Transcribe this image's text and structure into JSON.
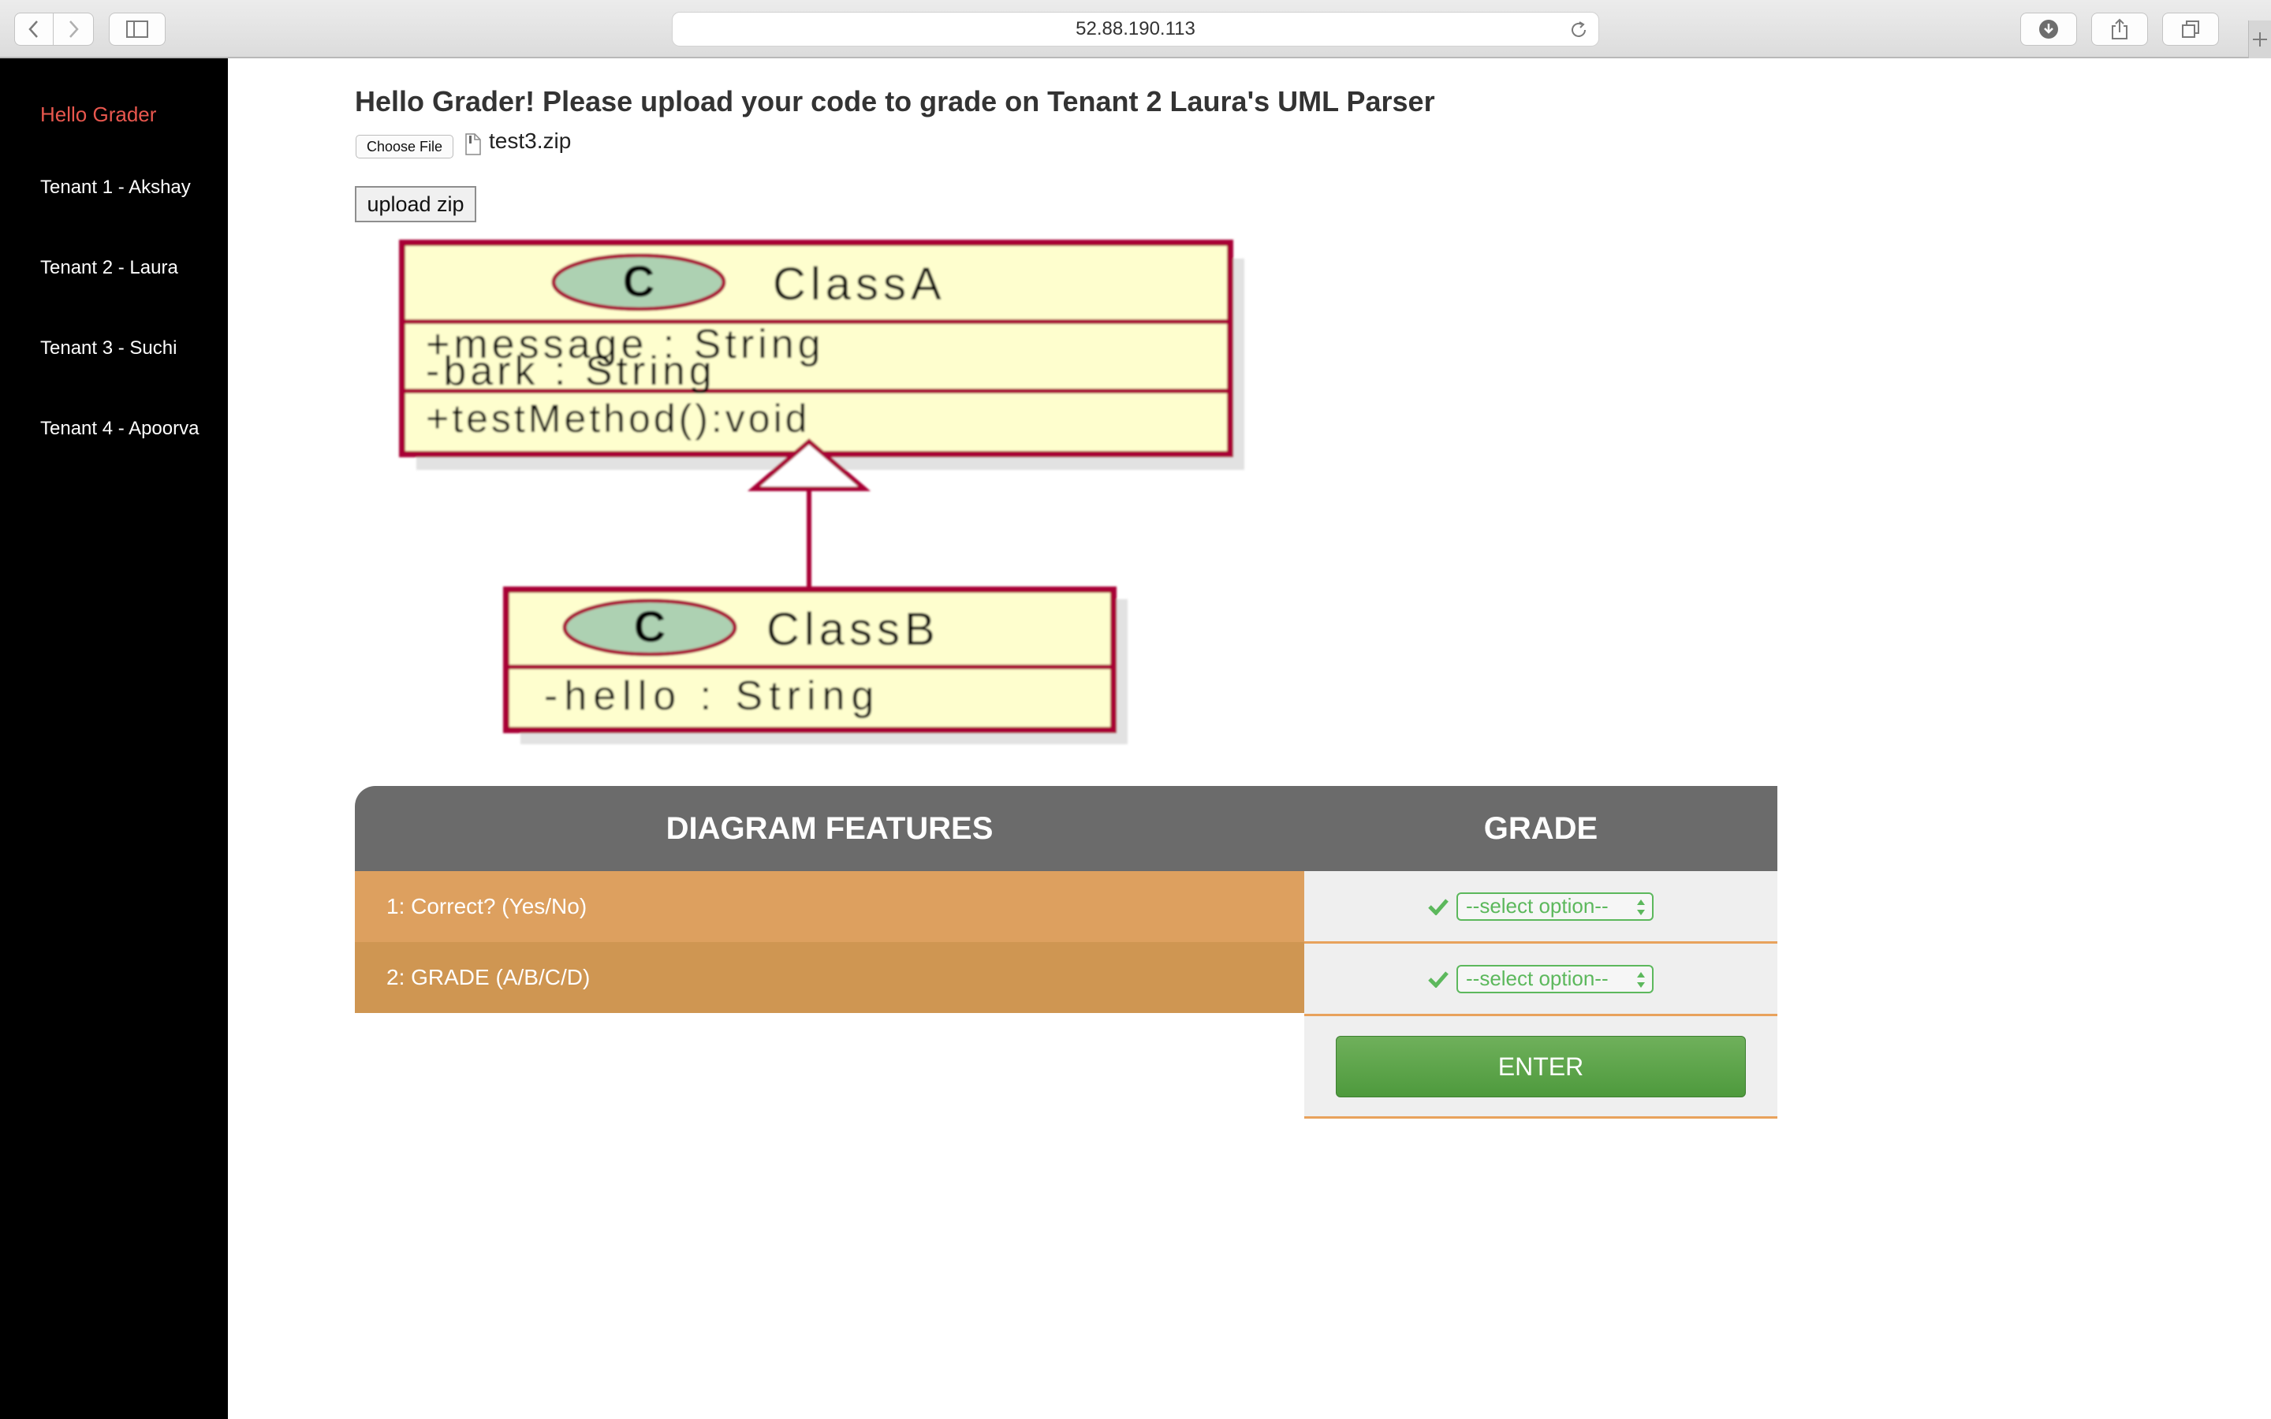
{
  "browser": {
    "url": "52.88.190.113"
  },
  "sidebar": {
    "items": [
      {
        "label": "Hello Grader",
        "active": true
      },
      {
        "label": "Tenant 1 - Akshay"
      },
      {
        "label": "Tenant 2 - Laura"
      },
      {
        "label": "Tenant 3 - Suchi"
      },
      {
        "label": "Tenant 4 - Apoorva"
      }
    ]
  },
  "main": {
    "heading": "Hello Grader! Please upload your code to grade on Tenant 2 Laura's UML Parser",
    "choose_file_label": "Choose File",
    "file_name": "test3.zip",
    "upload_label": "upload zip",
    "diagram": {
      "class_a": {
        "stereotype": "C",
        "name": "ClassA",
        "attributes": [
          "+message : String",
          "-bark : String"
        ],
        "methods": [
          "+testMethod():void"
        ]
      },
      "class_b": {
        "stereotype": "C",
        "name": "ClassB",
        "attributes": [
          "-hello : String"
        ]
      }
    }
  },
  "grade_table": {
    "headers": [
      "DIAGRAM FEATURES",
      "GRADE"
    ],
    "rows": [
      {
        "feature": "1: Correct? (Yes/No)",
        "select": "--select option--"
      },
      {
        "feature": "2: GRADE (A/B/C/D)",
        "select": "--select option--"
      }
    ],
    "enter_label": "ENTER"
  },
  "colors": {
    "sidebar_bg": "#000000",
    "sidebar_active": "#e8574e",
    "table_header": "#6b6b6b",
    "row_1": "#dda05f",
    "row_2": "#cf9652",
    "select_green": "#5cb85c",
    "enter_green": "#5ca54a",
    "uml_fill": "#fefece",
    "uml_border": "#a80036",
    "uml_circle": "#add1b2"
  }
}
